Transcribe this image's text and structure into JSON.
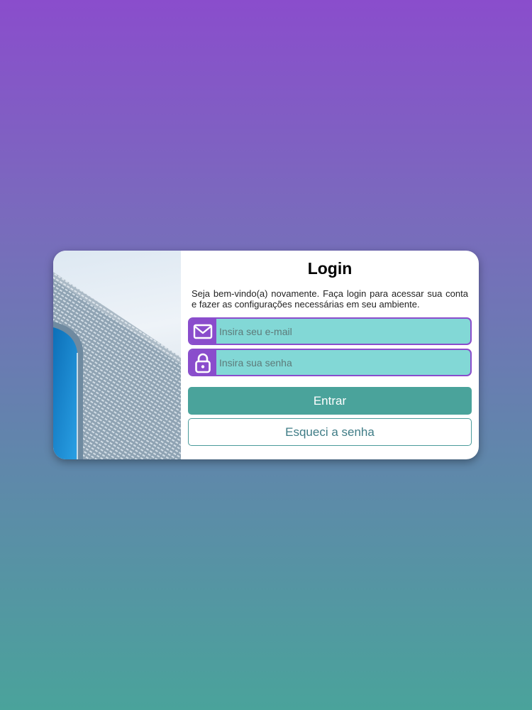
{
  "login": {
    "title": "Login",
    "description": "Seja bem-vindo(a) novamente. Faça login para acessar sua conta e fazer as configurações necessárias em seu ambiente.",
    "email_placeholder": "Insira seu e-mail",
    "password_placeholder": "Insira sua senha",
    "submit_label": "Entrar",
    "forgot_label": "Esqueci a senha"
  },
  "icons": {
    "email": "envelope-icon",
    "password": "lock-icon"
  },
  "colors": {
    "accent": "#8a4dcc",
    "field_bg": "#82d8d6",
    "primary_button": "#4aa39b",
    "secondary_border": "#4a9b9b"
  }
}
